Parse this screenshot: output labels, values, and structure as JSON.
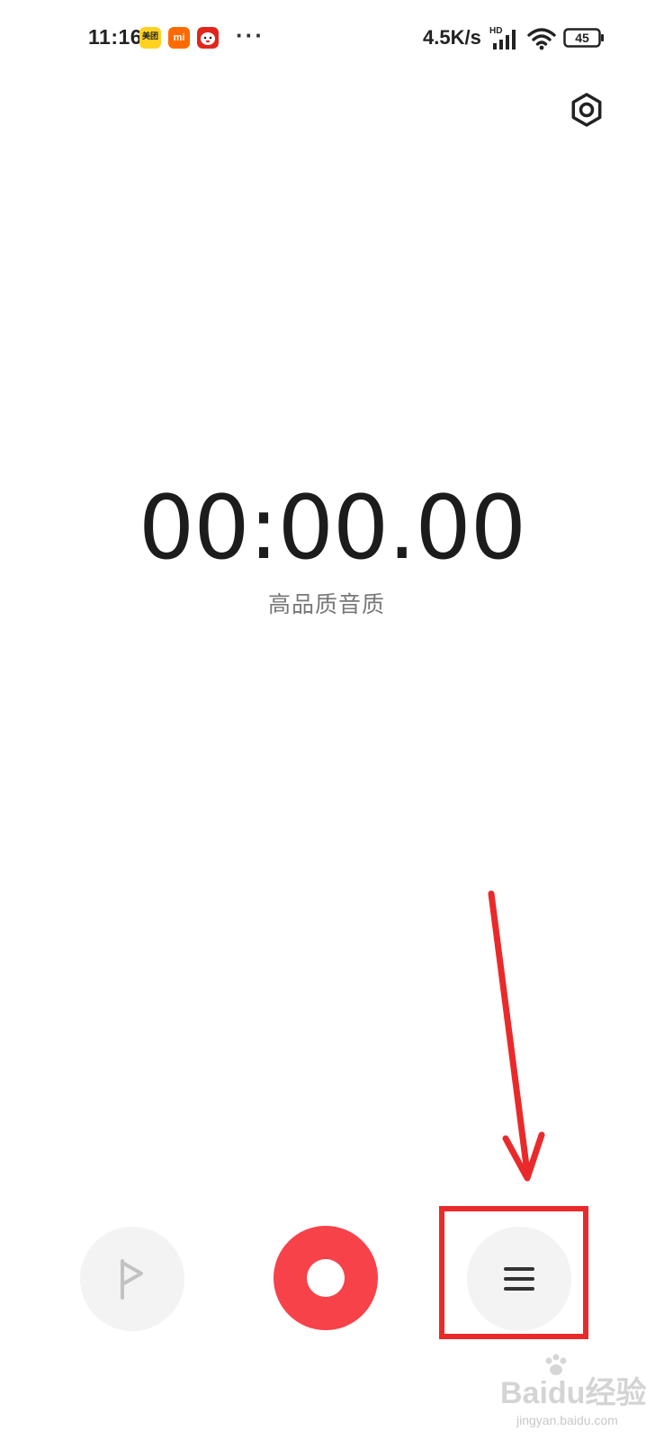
{
  "status_bar": {
    "time": "11:16",
    "app_icons": [
      {
        "name": "meituan-icon",
        "label": "美团"
      },
      {
        "name": "xiaomi-icon",
        "label": "mi"
      },
      {
        "name": "jd-icon",
        "label": ""
      }
    ],
    "more": "···",
    "net_speed": "4.5K/s",
    "network_badge": "HD",
    "battery_level": "45"
  },
  "recorder": {
    "timer": "00:00.00",
    "quality": "高品质音质"
  },
  "controls": {
    "flag_icon": "flag-icon",
    "record_icon": "record-icon",
    "list_icon": "list-icon"
  },
  "colors": {
    "record_red": "#f7424a",
    "annotation_red": "#ea2a2a",
    "control_gray": "#f3f3f3"
  },
  "watermark": {
    "main": "Baidu经验",
    "sub": "jingyan.baidu.com"
  }
}
